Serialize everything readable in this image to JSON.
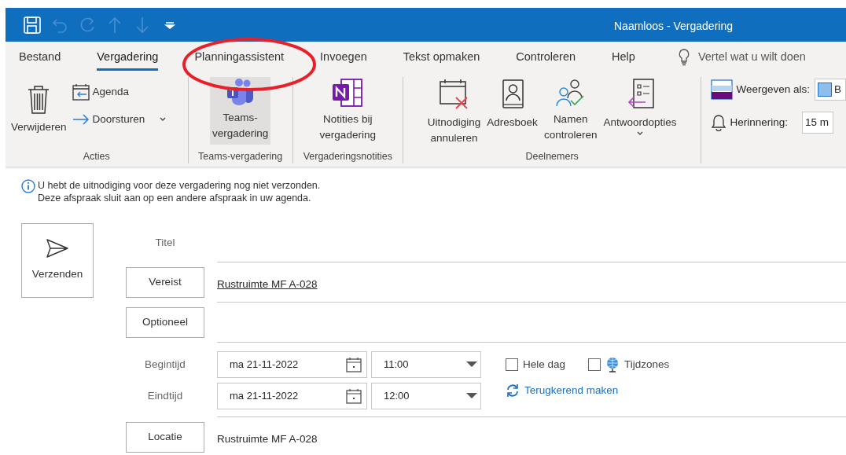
{
  "window": {
    "title": "Naamloos - Vergadering"
  },
  "quick_access": [
    {
      "kind": "save",
      "disabled": false
    },
    {
      "kind": "undo",
      "disabled": true
    },
    {
      "kind": "redo",
      "disabled": true
    },
    {
      "kind": "up",
      "disabled": true
    },
    {
      "kind": "down",
      "disabled": true
    },
    {
      "kind": "customize",
      "disabled": false
    }
  ],
  "tabs": [
    {
      "label": "Bestand",
      "selected": false
    },
    {
      "label": "Vergadering",
      "selected": true
    },
    {
      "label": "Planningassistent",
      "selected": false
    },
    {
      "label": "Invoegen",
      "selected": false
    },
    {
      "label": "Tekst opmaken",
      "selected": false
    },
    {
      "label": "Controleren",
      "selected": false
    },
    {
      "label": "Help",
      "selected": false
    }
  ],
  "tell_me": "Vertel wat u wilt doen",
  "ribbon": {
    "groups": [
      {
        "label": "Acties",
        "items": [
          {
            "kind": "large",
            "label": "Verwijderen",
            "highlighted": false
          },
          {
            "kind": "small",
            "label": "Agenda",
            "highlighted": false
          },
          {
            "kind": "small",
            "label": "Doorsturen",
            "dropdown": true,
            "highlighted": false
          }
        ]
      },
      {
        "label": "Teams-vergadering",
        "items": [
          {
            "kind": "large",
            "label": "Teams-\nvergadering",
            "highlighted": true
          }
        ]
      },
      {
        "label": "Vergaderingsnotities",
        "items": [
          {
            "kind": "large",
            "label": "Notities bij\nvergadering",
            "highlighted": false
          }
        ]
      },
      {
        "label": "Deelnemers",
        "items": [
          {
            "kind": "large",
            "label": "Uitnodiging\nannuleren",
            "highlighted": false
          },
          {
            "kind": "large",
            "label": "Adresboek",
            "highlighted": false
          },
          {
            "kind": "large",
            "label": "Namen\ncontroleren",
            "highlighted": false
          },
          {
            "kind": "large",
            "label": "Antwoordopties",
            "dropdown": true,
            "highlighted": false
          }
        ]
      }
    ],
    "side_fields": [
      {
        "label": "Weergeven als:",
        "value": "B"
      },
      {
        "label": "Herinnering:",
        "value": "15 m"
      }
    ]
  },
  "info_messages": [
    "U hebt de uitnodiging voor deze vergadering nog niet verzonden.",
    "Deze afspraak sluit aan op een andere afspraak in uw agenda."
  ],
  "form": {
    "send": "Verzenden",
    "title": {
      "label": "Titel"
    },
    "required": {
      "label": "Vereist",
      "value": "Rustruimte MF A-028",
      "underlined": true
    },
    "optional": {
      "label": "Optioneel"
    },
    "start": {
      "label": "Begintijd",
      "date": "ma 21-11-2022",
      "time": "11:00"
    },
    "end": {
      "label": "Eindtijd",
      "date": "ma 21-11-2022",
      "time": "12:00"
    },
    "all_day": {
      "label": "Hele dag",
      "checked": false
    },
    "time_zones": {
      "label": "Tijdzones",
      "checked": false
    },
    "recurrence": "Terugkerend maken",
    "location": {
      "label": "Locatie",
      "value": "Rustruimte MF A-028"
    }
  },
  "annotation": {
    "kind": "ellipse",
    "color": "#e8202a"
  }
}
